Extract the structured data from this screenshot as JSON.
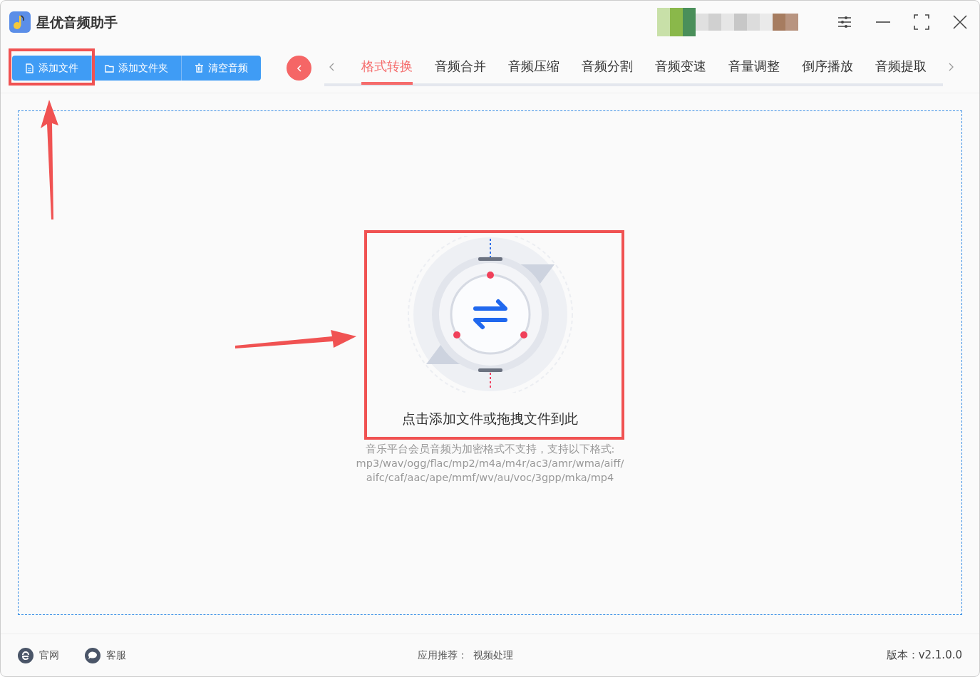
{
  "app": {
    "title": "星优音频助手"
  },
  "toolbar": [
    {
      "label": "添加文件",
      "kind": "file"
    },
    {
      "label": "添加文件夹",
      "kind": "folder"
    },
    {
      "label": "清空音频",
      "kind": "trash"
    }
  ],
  "tabs": [
    {
      "label": "格式转换",
      "selected": true
    },
    {
      "label": "音频合并",
      "selected": false
    },
    {
      "label": "音频压缩",
      "selected": false
    },
    {
      "label": "音频分割",
      "selected": false
    },
    {
      "label": "音频变速",
      "selected": false
    },
    {
      "label": "音量调整",
      "selected": false
    },
    {
      "label": "倒序播放",
      "selected": false
    },
    {
      "label": "音频提取",
      "selected": false
    }
  ],
  "drop_zone": {
    "prompt": "点击添加文件或拖拽文件到此",
    "note_lines": [
      "音乐平台会员音频为加密格式不支持，支持以下格式:",
      "mp3/wav/ogg/flac/mp2/m4a/m4r/ac3/amr/wma/aiff/",
      "aifc/caf/aac/ape/mmf/wv/au/voc/3gpp/mka/mp4"
    ]
  },
  "footer": {
    "links": [
      {
        "label": "官网",
        "kind": "web"
      },
      {
        "label": "客服",
        "kind": "chat"
      }
    ],
    "recommend_label": "应用推荐：",
    "recommend_link": "视频处理",
    "version": "版本：v2.1.0.0"
  }
}
